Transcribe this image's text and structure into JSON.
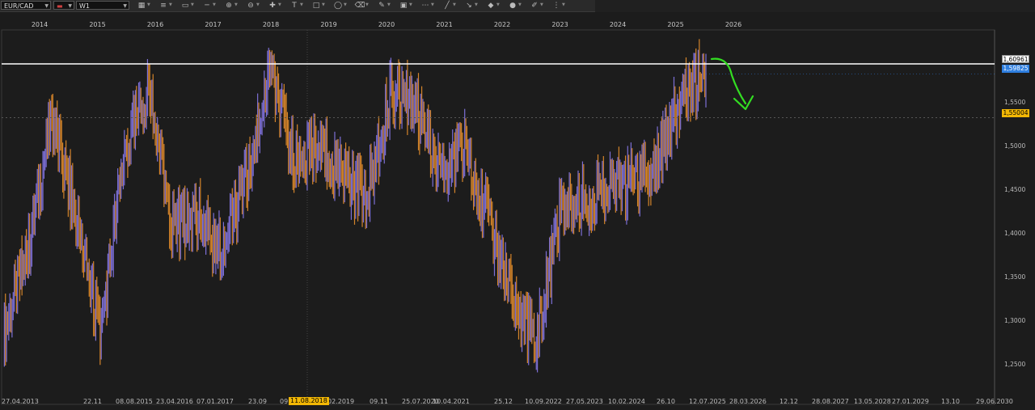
{
  "toolbar": {
    "symbol": "EUR/CAD",
    "timeframe": "W1",
    "icons": [
      "bar-chart-icon",
      "line-style-icon",
      "horizontal-line-icon",
      "trend-line-icon",
      "zoom-in-icon",
      "zoom-out-icon",
      "crosshair-icon",
      "text-tool-icon",
      "rectangle-icon",
      "ellipse-icon",
      "eraser-icon",
      "pencil-icon",
      "screenshot-icon",
      "fib-icon",
      "channel-icon",
      "arrow-icon",
      "shapes-icon",
      "marker-icon",
      "brush-icon",
      "more-icon"
    ]
  },
  "years": [
    "2014",
    "2015",
    "2016",
    "2017",
    "2018",
    "2019",
    "2020",
    "2021",
    "2022",
    "2023",
    "2024",
    "2025",
    "2026"
  ],
  "price_axis": {
    "ticks": [
      "1,5500",
      "1,5000",
      "1,4500",
      "1,4000",
      "1,3500",
      "1,3000",
      "1,2500"
    ],
    "resistance_label": "1,60961",
    "current_label": "1,59825",
    "level_label": "1,55004"
  },
  "time_axis": {
    "labels": [
      "27.04.2013",
      "22.11",
      "08.08.2015",
      "23.04.2016",
      "07.01.2017",
      "23.09",
      "09.",
      "02.2019",
      "09.11",
      "25.07.2020",
      "10.04.2021",
      "25.12",
      "10.09.2022",
      "27.05.2023",
      "10.02.2024",
      "26.10",
      "12.07.2025",
      "28.03.2026",
      "12.12",
      "28.08.2027",
      "13.05.2028",
      "27.01.2029",
      "13.10",
      "29.06.2030"
    ],
    "cursor_date": "11.08.2018"
  },
  "colors": {
    "background": "#1c1c1c",
    "bull": "#7d6fd6",
    "bear": "#d4842a",
    "resistance": "#ffffff",
    "annotation": "#33dd22",
    "current_tag": "#2f7fe0",
    "level_tag": "#f2b705"
  },
  "chart_data": {
    "type": "line",
    "series": [
      {
        "x": [
          "2013-04",
          "2013-10",
          "2014-04",
          "2014-10",
          "2015-03",
          "2015-09",
          "2016-02",
          "2016-07",
          "2016-12",
          "2017-05",
          "2017-10",
          "2018-03",
          "2018-08",
          "2019-01",
          "2019-06",
          "2019-11",
          "2020-03",
          "2020-08",
          "2021-01",
          "2021-06",
          "2021-11",
          "2022-04",
          "2022-09",
          "2023-02",
          "2023-07",
          "2023-12",
          "2024-05",
          "2024-10",
          "2025-03",
          "2025-07"
        ],
        "values": [
          1.31,
          1.4,
          1.55,
          1.44,
          1.31,
          1.51,
          1.58,
          1.43,
          1.44,
          1.4,
          1.48,
          1.6,
          1.5,
          1.52,
          1.49,
          1.46,
          1.58,
          1.56,
          1.49,
          1.52,
          1.44,
          1.35,
          1.3,
          1.45,
          1.46,
          1.47,
          1.48,
          1.5,
          1.57,
          1.6
        ]
      }
    ],
    "horizontal_lines": [
      1.60961,
      1.55004
    ],
    "current": 1.59825,
    "ylim": [
      1.24,
      1.64
    ]
  }
}
